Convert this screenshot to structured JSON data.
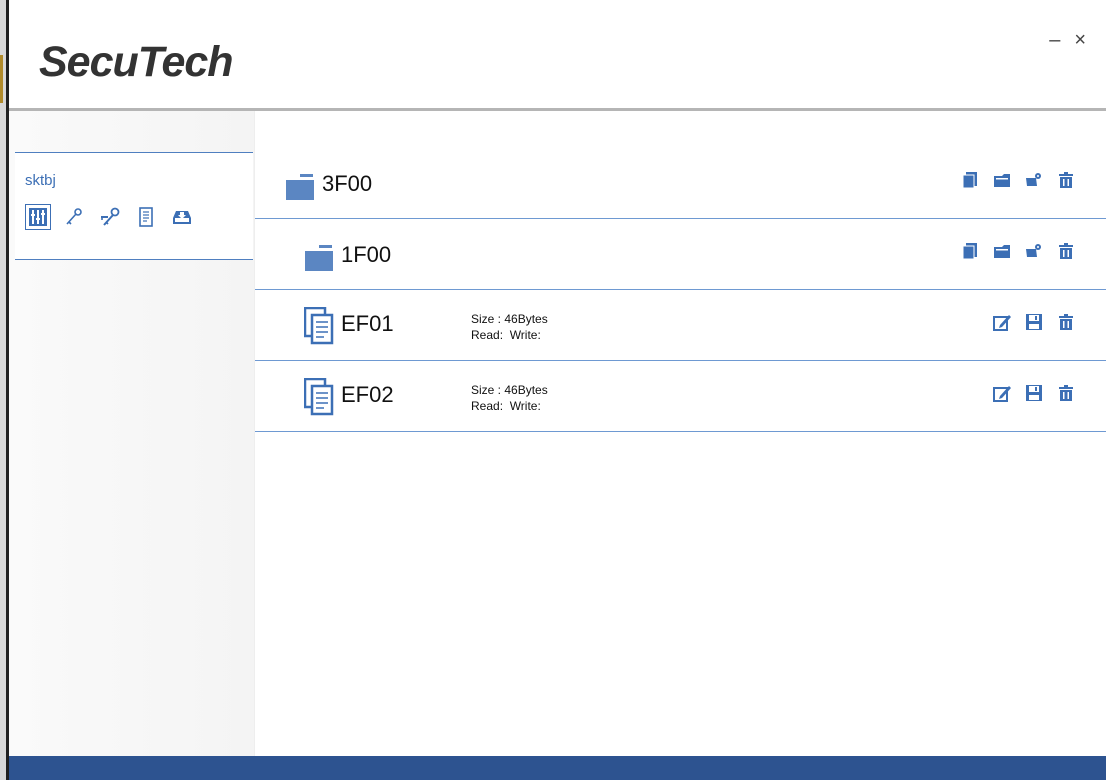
{
  "app": {
    "logo_text": "SecuTech",
    "minimize_label": "–",
    "close_label": "×"
  },
  "sidebar": {
    "user_name": "sktbj",
    "tools": [
      {
        "icon": "dashboard-icon",
        "active": true
      },
      {
        "icon": "key-icon",
        "active": false
      },
      {
        "icon": "keys-icon",
        "active": false
      },
      {
        "icon": "document-icon",
        "active": false
      },
      {
        "icon": "download-icon",
        "active": false
      }
    ]
  },
  "tree": {
    "df1": {
      "name": "3F00",
      "icon": "folder-icon",
      "actions": [
        "copy-icon",
        "folder-add-icon",
        "key-settings-icon",
        "trash-icon"
      ]
    },
    "df2": {
      "name": "1F00",
      "icon": "folder-icon",
      "actions": [
        "copy-icon",
        "folder-add-icon",
        "key-settings-icon",
        "trash-icon"
      ]
    },
    "ef1": {
      "name": "EF01",
      "icon": "file-stack-icon",
      "size": "Size : 46Bytes",
      "access": "Read:  Write:",
      "actions": [
        "edit-icon",
        "save-icon",
        "trash-icon"
      ]
    },
    "ef2": {
      "name": "EF02",
      "icon": "file-stack-icon",
      "size": "Size : 46Bytes",
      "access": "Read:  Write:",
      "actions": [
        "edit-icon",
        "save-icon",
        "trash-icon"
      ]
    }
  },
  "colors": {
    "accent": "#3c6fb5",
    "status_bar": "#2d5390",
    "divider": "#6e99d2"
  }
}
